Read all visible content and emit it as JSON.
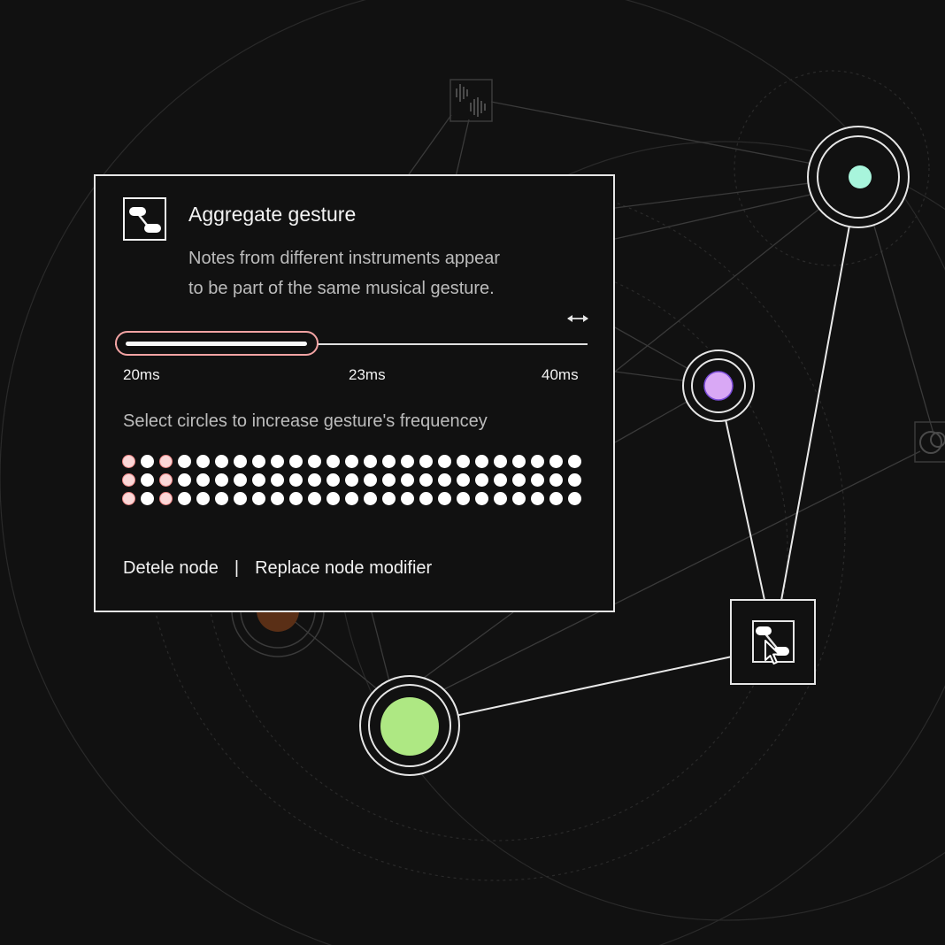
{
  "panel": {
    "title": "Aggregate gesture",
    "description": "Notes from different instruments appear\nto be part of the same musical gesture.",
    "slider": {
      "min_label": "20ms",
      "value_label": "23ms",
      "max_label": "40ms",
      "min": 20,
      "value": 23,
      "max": 40
    },
    "frequency_label": "Select circles to increase gesture's frequencey",
    "dot_grid": {
      "rows": 3,
      "columns": 25,
      "selected_columns": [
        0,
        2
      ]
    },
    "actions": {
      "delete_label": "Detele node",
      "separator": "|",
      "replace_label": "Replace node modifier"
    }
  },
  "icons": [
    "aggregate-gesture-icon",
    "resize-horizontal-icon",
    "waveform-node-icon",
    "overlap-node-icon",
    "pointer-cursor-icon"
  ],
  "colors": {
    "background": "#111111",
    "panel_border": "#e6e6e6",
    "selected_dot": "#fbd7d7",
    "selected_dot_outline": "#f08787",
    "node_green": "#aee883",
    "node_teal": "#a8f5dc",
    "node_purple": "#d9a8f5",
    "node_orange": "#5a2f16"
  }
}
